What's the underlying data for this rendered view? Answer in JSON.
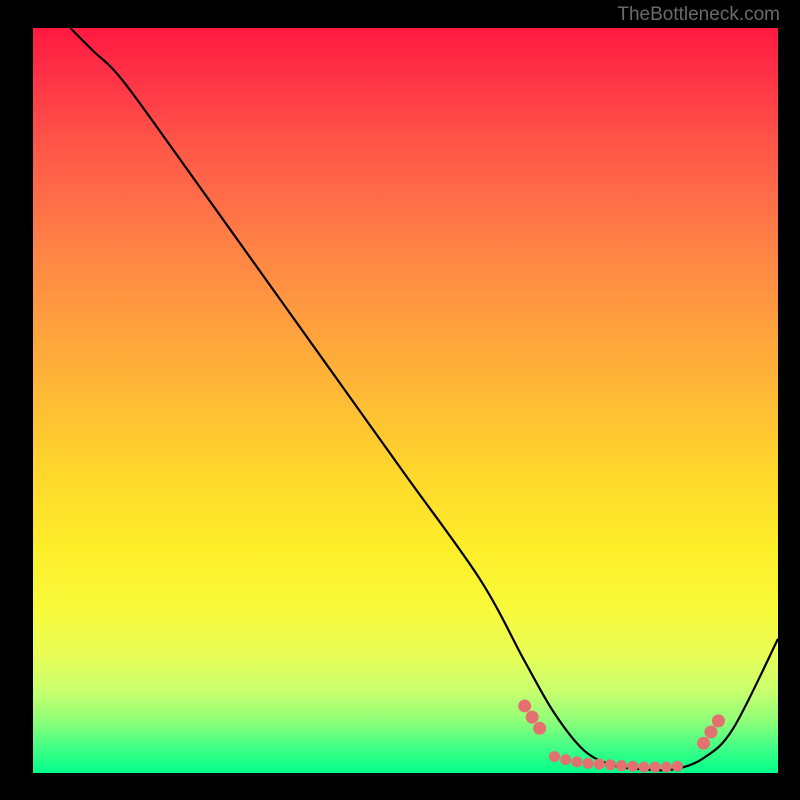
{
  "attribution": "TheBottleneck.com",
  "chart_data": {
    "type": "line",
    "title": "",
    "xlabel": "",
    "ylabel": "",
    "xlim": [
      0,
      100
    ],
    "ylim": [
      0,
      100
    ],
    "series": [
      {
        "name": "bottleneck-curve",
        "x": [
          5,
          8,
          12,
          20,
          30,
          40,
          50,
          60,
          66,
          70,
          74,
          78,
          82,
          86,
          90,
          94,
          100
        ],
        "y": [
          100,
          97,
          93,
          82,
          68,
          54,
          40,
          26,
          15,
          8,
          3,
          1,
          0.5,
          0.5,
          2,
          6,
          18
        ]
      }
    ],
    "markers": {
      "name": "highlighted-points",
      "color": "#e47070",
      "points": [
        {
          "x": 66,
          "y": 9.0
        },
        {
          "x": 67,
          "y": 7.5
        },
        {
          "x": 68,
          "y": 6.0
        },
        {
          "x": 70,
          "y": 2.2
        },
        {
          "x": 71.5,
          "y": 1.8
        },
        {
          "x": 73,
          "y": 1.5
        },
        {
          "x": 74.5,
          "y": 1.3
        },
        {
          "x": 76,
          "y": 1.2
        },
        {
          "x": 77.5,
          "y": 1.1
        },
        {
          "x": 79,
          "y": 1.0
        },
        {
          "x": 80.5,
          "y": 0.9
        },
        {
          "x": 82,
          "y": 0.8
        },
        {
          "x": 83.5,
          "y": 0.8
        },
        {
          "x": 85,
          "y": 0.8
        },
        {
          "x": 86.5,
          "y": 0.9
        },
        {
          "x": 90,
          "y": 4.0
        },
        {
          "x": 91,
          "y": 5.5
        },
        {
          "x": 92,
          "y": 7.0
        }
      ]
    },
    "background": "vertical-gradient-red-to-green"
  }
}
